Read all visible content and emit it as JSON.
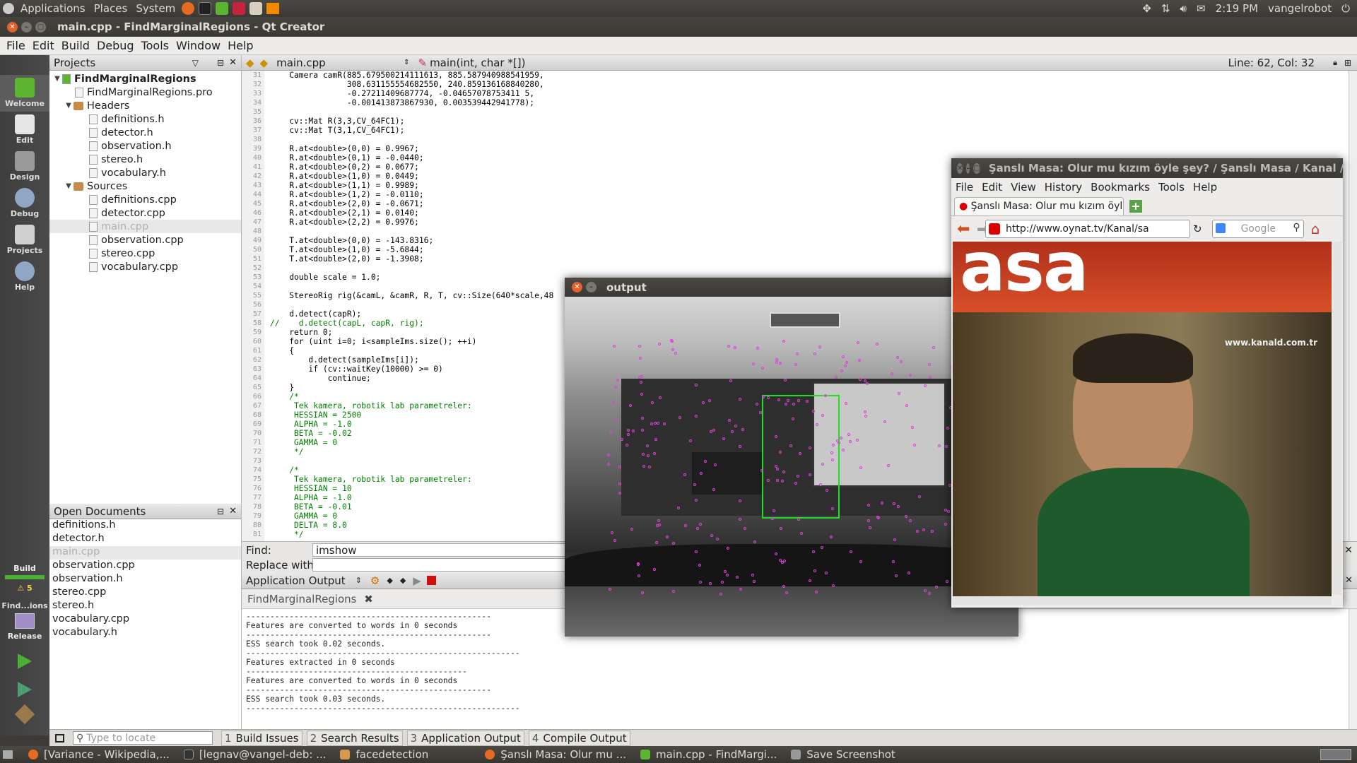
{
  "top_panel": {
    "menus": [
      "Applications",
      "Places",
      "System"
    ],
    "clock": "2:19 PM",
    "user": "vangelrobot"
  },
  "window_title": "main.cpp - FindMarginalRegions - Qt Creator",
  "menubar": [
    "File",
    "Edit",
    "Build",
    "Debug",
    "Tools",
    "Window",
    "Help"
  ],
  "modes": [
    "Welcome",
    "Edit",
    "Design",
    "Debug",
    "Projects",
    "Help"
  ],
  "build_section": {
    "label": "Build",
    "warnings": "5",
    "project_short": "Find...ions",
    "config": "Release"
  },
  "projects_panel": {
    "header": "Projects",
    "project": "FindMarginalRegions",
    "pro_file": "FindMarginalRegions.pro",
    "headers_label": "Headers",
    "headers": [
      "definitions.h",
      "detector.h",
      "observation.h",
      "stereo.h",
      "vocabulary.h"
    ],
    "sources_label": "Sources",
    "sources": [
      "definitions.cpp",
      "detector.cpp",
      "main.cpp",
      "observation.cpp",
      "stereo.cpp",
      "vocabulary.cpp"
    ]
  },
  "open_documents": {
    "header": "Open Documents",
    "items": [
      "definitions.h",
      "detector.h",
      "main.cpp",
      "observation.cpp",
      "observation.h",
      "stereo.cpp",
      "stereo.h",
      "vocabulary.cpp",
      "vocabulary.h"
    ]
  },
  "editor": {
    "file": "main.cpp",
    "function": "main(int, char *[])",
    "position": "Line: 62, Col: 32",
    "line_numbers": [
      "31",
      "32",
      "33",
      "34",
      "35",
      "36",
      "37",
      "38",
      "39",
      "40",
      "41",
      "42",
      "43",
      "44",
      "45",
      "46",
      "47",
      "48",
      "49",
      "50",
      "51",
      "52",
      "53",
      "54",
      "55",
      "56",
      "57",
      "58",
      "59",
      "60",
      "61",
      "62",
      "63",
      "64",
      "65",
      "66",
      "67",
      "68",
      "69",
      "70",
      "71",
      "72",
      "73",
      "74",
      "75",
      "76",
      "77",
      "78",
      "79",
      "80",
      "81"
    ],
    "lines": [
      "    Camera camR(885.679500214111613, 885.587940988541959,",
      "                308.631155554682550, 240.859136168840280,",
      "                -0.27211409687774, -0.04657078753411 5,",
      "                -0.001413873867930, 0.003539442941778);",
      "",
      "    cv::Mat R(3,3,CV_64FC1);",
      "    cv::Mat T(3,1,CV_64FC1);",
      "",
      "    R.at<double>(0,0) = 0.9967;",
      "    R.at<double>(0,1) = -0.0440;",
      "    R.at<double>(0,2) = 0.0677;",
      "    R.at<double>(1,0) = 0.0449;",
      "    R.at<double>(1,1) = 0.9989;",
      "    R.at<double>(1,2) = -0.0110;",
      "    R.at<double>(2,0) = -0.0671;",
      "    R.at<double>(2,1) = 0.0140;",
      "    R.at<double>(2,2) = 0.9976;",
      "",
      "    T.at<double>(0,0) = -143.8316;",
      "    T.at<double>(1,0) = -5.6844;",
      "    T.at<double>(2,0) = -1.3908;",
      "",
      "    double scale = 1.0;",
      "",
      "    StereoRig rig(&camL, &camR, R, T, cv::Size(640*scale,48",
      "",
      "    d.detect(capR);",
      "//    d.detect(capL, capR, rig);",
      "    return 0;",
      "    for (uint i=0; i<sampleIms.size(); ++i)",
      "    {",
      "        d.detect(sampleIms[i]);",
      "        if (cv::waitKey(10000) >= 0)",
      "            continue;",
      "    }",
      "    /*",
      "     Tek kamera, robotik lab parametreler:",
      "     HESSIAN = 2500",
      "     ALPHA = -1.0",
      "     BETA = -0.02",
      "     GAMMA = 0",
      "     */",
      "",
      "    /*",
      "     Tek kamera, robotik lab parametreler:",
      "     HESSIAN = 10",
      "     ALPHA = -1.0",
      "     BETA = -0.01",
      "     GAMMA = 0",
      "     DELTA = 8.0",
      "     */"
    ]
  },
  "find": {
    "find_label": "Find:",
    "find_value": "imshow",
    "replace_label": "Replace with:"
  },
  "output_pane": {
    "header": "Application Output",
    "tab": "FindMarginalRegions",
    "lines": [
      "---------------------------------------------------",
      "Features are converted to words in 0 seconds",
      "---------------------------------------------------",
      "ESS search took 0.02 seconds.",
      "---------------------------------------------------------",
      "Features extracted in 0 seconds",
      "----------------------------------------------",
      "Features are converted to words in 0 seconds",
      "---------------------------------------------------",
      "ESS search took 0.03 seconds.",
      "---------------------------------------------------------"
    ]
  },
  "bottom_bar": {
    "locate_placeholder": "Type to locate",
    "tabs": [
      {
        "num": "1",
        "label": "Build Issues"
      },
      {
        "num": "2",
        "label": "Search Results"
      },
      {
        "num": "3",
        "label": "Application Output"
      },
      {
        "num": "4",
        "label": "Compile Output"
      }
    ]
  },
  "output_window": {
    "title": "output"
  },
  "firefox": {
    "title": "Şanslı Masa: Olur mu kızım öyle şey? / Şanslı Masa / Kanal / Oy",
    "menu": [
      "File",
      "Edit",
      "View",
      "History",
      "Bookmarks",
      "Tools",
      "Help"
    ],
    "tab_title": "Şanslı Masa: Olur mu kızım öyl...",
    "url": "http://www.oynat.tv/Kanal/sa",
    "search_placeholder": "Google",
    "banner_text": "asa",
    "watermark": "www.kanald.com.tr"
  },
  "taskbar": {
    "items": [
      "[Variance - Wikipedia,...",
      "[legnav@vangel-deb: ...",
      "facedetection",
      "Şanslı Masa: Olur mu ...",
      "main.cpp - FindMargi...",
      "Save Screenshot"
    ]
  },
  "colors": {
    "ubuntu_panel": "#3c3b37",
    "close_button": "#e2602c",
    "detection_box": "#22dd22",
    "keypoints": "#e040e0",
    "banner_red": "#c8301a",
    "tv_shirt": "#1f5a2c"
  }
}
